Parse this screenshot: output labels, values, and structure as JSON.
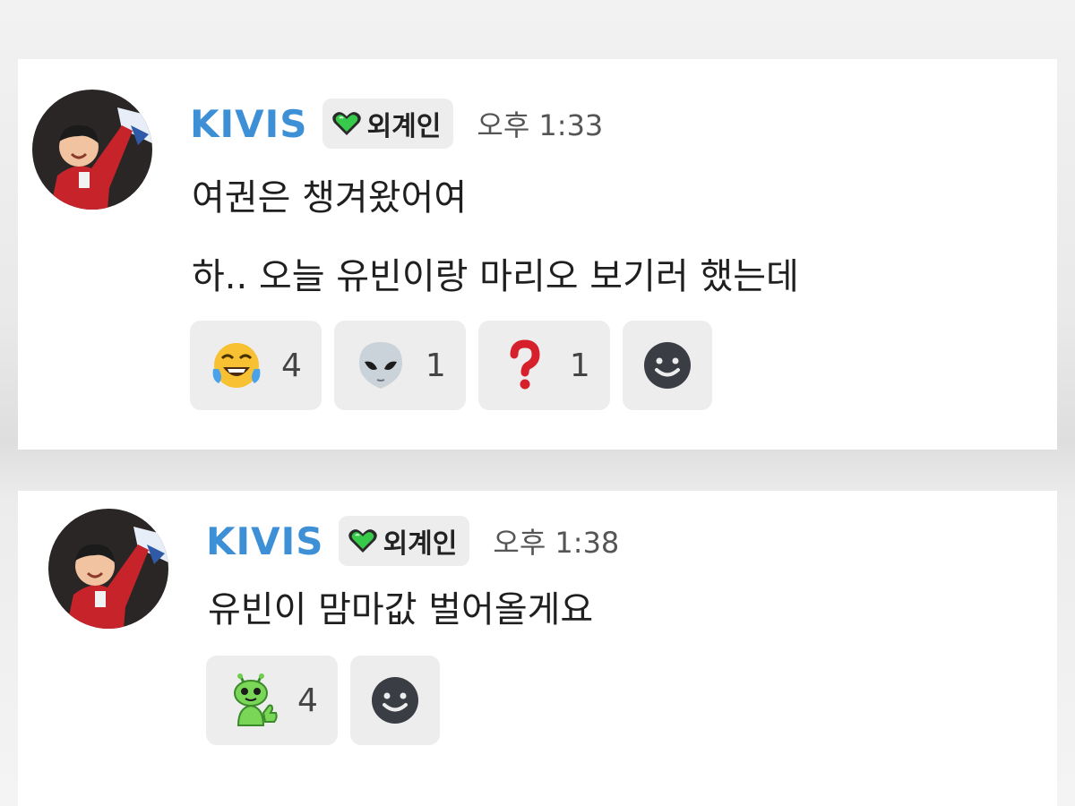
{
  "messages": [
    {
      "username": "KIVIS",
      "badge": "외계인",
      "time": "오후 1:33",
      "lines": [
        "여권은 챙겨왔어여",
        "하.. 오늘 유빈이랑 마리오 보기러 했는데"
      ],
      "reactions": [
        {
          "icon": "laughing-tears-emoji-icon",
          "count": "4"
        },
        {
          "icon": "alien-emoji-icon",
          "count": "1"
        },
        {
          "icon": "red-question-mark-icon",
          "count": "1"
        }
      ]
    },
    {
      "username": "KIVIS",
      "badge": "외계인",
      "time": "오후 1:38",
      "lines": [
        "유빈이 맘마값 벌어올게요"
      ],
      "reactions": [
        {
          "icon": "green-alien-thumbs-up-icon",
          "count": "4"
        }
      ]
    }
  ],
  "colors": {
    "username": "#3d8fd6",
    "chip_bg": "#ededed",
    "badge_heart": "#37c94a"
  }
}
